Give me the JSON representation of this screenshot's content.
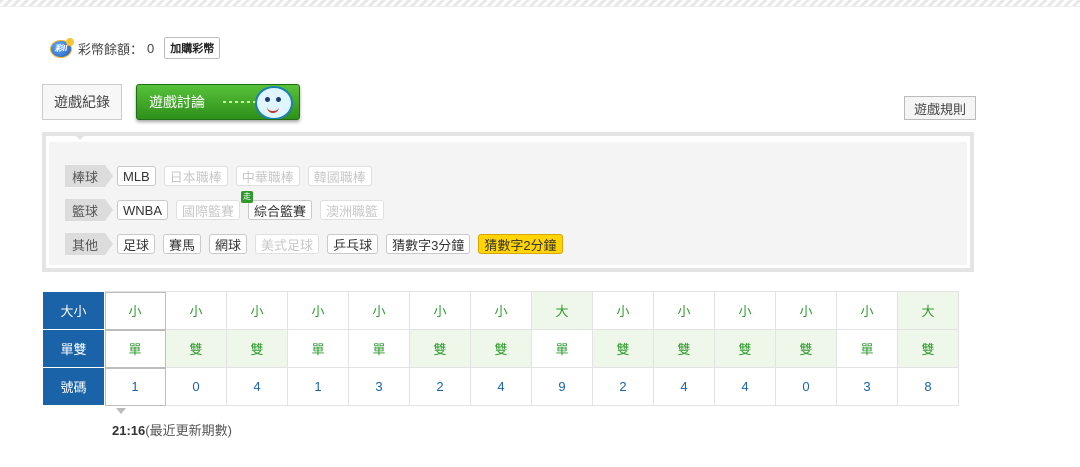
{
  "balance": {
    "coin_icon_text": "彩II",
    "label": "彩幣餘額：",
    "value": "0",
    "buy_label": "加購彩幣"
  },
  "tabs": {
    "records": "遊戲紀錄",
    "discussion": "遊戲討論"
  },
  "rules_label": "遊戲規則",
  "categories": {
    "baseball": {
      "label": "棒球",
      "items": [
        {
          "label": "MLB",
          "state": "normal"
        },
        {
          "label": "日本職棒",
          "state": "disabled"
        },
        {
          "label": "中華職棒",
          "state": "disabled"
        },
        {
          "label": "韓國職棒",
          "state": "disabled"
        }
      ]
    },
    "basketball": {
      "label": "籃球",
      "items": [
        {
          "label": "WNBA",
          "state": "normal"
        },
        {
          "label": "國際籃賽",
          "state": "disabled"
        },
        {
          "label": "綜合籃賽",
          "state": "normal",
          "badge": "走"
        },
        {
          "label": "澳洲職籃",
          "state": "disabled"
        }
      ]
    },
    "other": {
      "label": "其他",
      "items": [
        {
          "label": "足球",
          "state": "normal"
        },
        {
          "label": "賽馬",
          "state": "normal"
        },
        {
          "label": "網球",
          "state": "normal"
        },
        {
          "label": "美式足球",
          "state": "disabled"
        },
        {
          "label": "乒乓球",
          "state": "normal"
        },
        {
          "label": "猜數字3分鐘",
          "state": "normal"
        },
        {
          "label": "猜數字2分鐘",
          "state": "active"
        }
      ]
    }
  },
  "results": {
    "headers": [
      "大小",
      "單雙",
      "號碼"
    ],
    "size": [
      "小",
      "小",
      "小",
      "小",
      "小",
      "小",
      "小",
      "大",
      "小",
      "小",
      "小",
      "小",
      "小",
      "大"
    ],
    "parity": [
      "單",
      "雙",
      "雙",
      "單",
      "單",
      "雙",
      "雙",
      "單",
      "雙",
      "雙",
      "雙",
      "雙",
      "單",
      "雙"
    ],
    "numbers": [
      "1",
      "0",
      "4",
      "1",
      "3",
      "2",
      "4",
      "9",
      "2",
      "4",
      "4",
      "0",
      "3",
      "8"
    ]
  },
  "update": {
    "time": "21:16",
    "note": "(最近更新期數)"
  },
  "colors": {
    "header_blue": "#1a63a8",
    "green_text": "#2e9a2e",
    "active_yellow": "#ffd400",
    "tab_green": "#3aa324"
  }
}
